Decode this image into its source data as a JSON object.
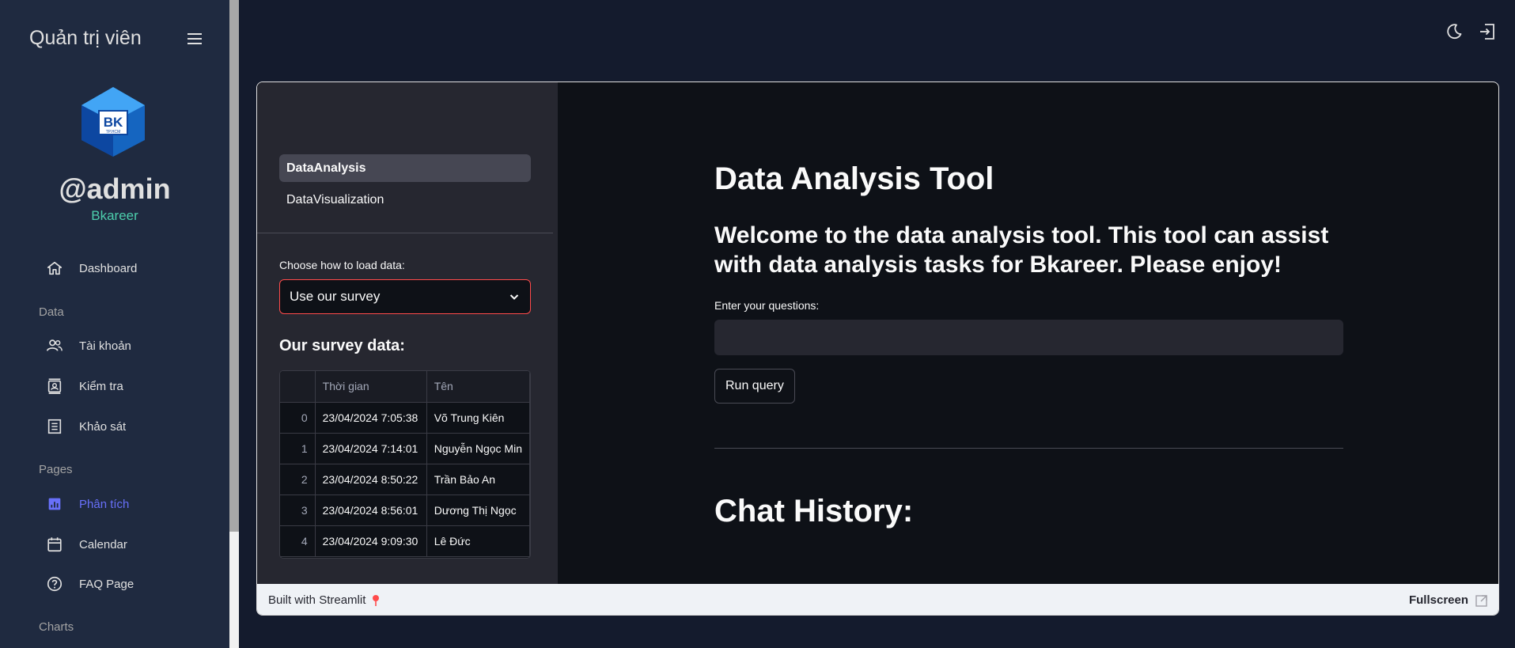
{
  "sidebar": {
    "title": "Quản trị viên",
    "username": "@admin",
    "role": "Bkareer",
    "logo_text": "BK",
    "logo_subtext": "TP.HCM",
    "items": [
      {
        "label": "Dashboard",
        "icon": "home-icon"
      },
      {
        "section": "Data"
      },
      {
        "label": "Tài khoản",
        "icon": "people-icon"
      },
      {
        "label": "Kiểm tra",
        "icon": "contacts-icon"
      },
      {
        "label": "Khảo sát",
        "icon": "receipt-icon"
      },
      {
        "section": "Pages"
      },
      {
        "label": "Phân tích",
        "icon": "analytics-icon",
        "active": true
      },
      {
        "label": "Calendar",
        "icon": "calendar-icon"
      },
      {
        "label": "FAQ Page",
        "icon": "help-icon"
      },
      {
        "section": "Charts"
      }
    ],
    "sections": [
      "Data",
      "Pages",
      "Charts"
    ]
  },
  "topbar": {
    "icons": [
      "dark-mode-icon",
      "logout-icon"
    ]
  },
  "streamlit": {
    "nav": [
      "DataAnalysis",
      "DataVisualization"
    ],
    "load_label": "Choose how to load data:",
    "select_value": "Use our survey",
    "survey_title": "Our survey data:",
    "table": {
      "columns": [
        "",
        "Thời gian",
        "Tên"
      ],
      "rows": [
        [
          "0",
          "23/04/2024 7:05:38",
          "Võ Trung Kiên"
        ],
        [
          "1",
          "23/04/2024 7:14:01",
          "Nguyễn Ngọc Min"
        ],
        [
          "2",
          "23/04/2024 8:50:22",
          "Trần Bảo An"
        ],
        [
          "3",
          "23/04/2024 8:56:01",
          "Dương Thị Ngọc"
        ],
        [
          "4",
          "23/04/2024 9:09:30",
          "Lê Đức"
        ]
      ]
    },
    "main": {
      "title": "Data Analysis Tool",
      "welcome": "Welcome to the data analysis tool. This tool can assist with data analysis tasks for Bkareer. Please enjoy!",
      "question_label": "Enter your questions:",
      "question_value": "",
      "run_button": "Run query",
      "chat_title": "Chat History:"
    },
    "footer": {
      "built": "Built with Streamlit",
      "fullscreen": "Fullscreen"
    }
  },
  "colors": {
    "accent": "#6870fa",
    "role": "#4cceac",
    "select_border": "#ff4b4b"
  }
}
